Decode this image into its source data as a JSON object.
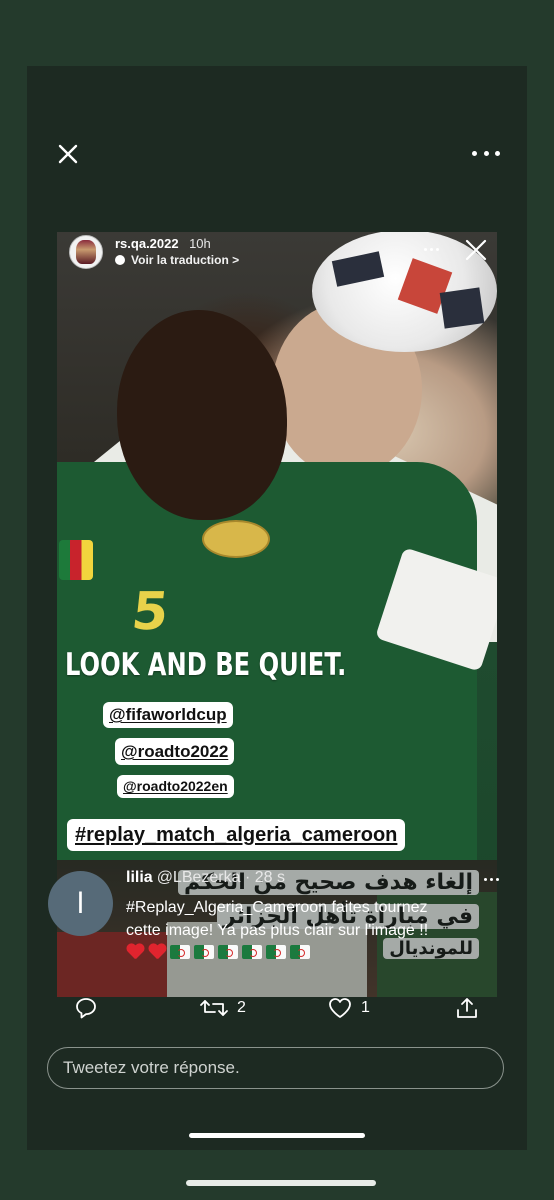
{
  "story": {
    "username": "rs.qa.2022",
    "time": "10h",
    "translate_label": "Voir la traduction >",
    "caption": "LOOK AND BE QUIET.",
    "tags": [
      "@fifaworldcup",
      "@roadto2022",
      "@roadto2022en",
      "#replay_match_algeria_cameroon"
    ],
    "arabic_lines": [
      "إلغاء هدف صحيح من الحكم",
      "في مباراة تأهل الجزائر",
      "للمونديال"
    ],
    "jersey_number": "5"
  },
  "tweet": {
    "avatar_initial": "l",
    "name": "lilia",
    "handle": "@LBezerka · 28 s",
    "line1": "#Replay_Algeria_Cameroon faites tournez",
    "line2": "cette image! Ya pas plus clair sur l'image !!",
    "emoji": [
      "red-heart",
      "red-heart",
      "flag-algeria",
      "flag-algeria",
      "flag-algeria",
      "flag-algeria",
      "flag-algeria",
      "flag-algeria"
    ]
  },
  "actions": {
    "reply_count": "",
    "retweet_count": "2",
    "like_count": "1"
  },
  "reply": {
    "placeholder": "Tweetez votre réponse."
  },
  "icons": {
    "close": "close-icon",
    "more": "more-icon",
    "reply": "reply-icon",
    "retweet": "retweet-icon",
    "like": "heart-icon",
    "share": "share-icon"
  },
  "colors": {
    "background": "#243a2c",
    "panel": "#1d2a22",
    "jersey_green": "#1d5a32",
    "heart_red": "#e0242e"
  }
}
